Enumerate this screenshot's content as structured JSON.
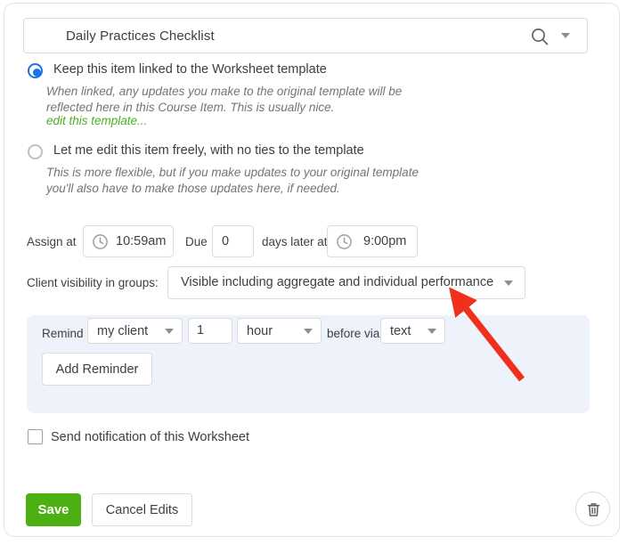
{
  "title_field": {
    "value": "Daily Practices Checklist",
    "search_icon": "search-icon",
    "dropdown_icon": "chevron-down-icon"
  },
  "options": {
    "linked": {
      "label": "Keep this item linked to the Worksheet template",
      "selected": true,
      "help": "When linked, any updates you make to the original template will be reflected here in this Course Item. This is usually nice.",
      "link_label": "edit this template..."
    },
    "free": {
      "label": "Let me edit this item freely, with no ties to the template",
      "selected": false,
      "help": "This is more flexible, but if you make updates to your original template you'll also have to make those updates here, if needed."
    }
  },
  "schedule": {
    "assign_label": "Assign at",
    "assign_time": "10:59am",
    "due_label": "Due",
    "due_days": "0",
    "days_later_label": "days later at",
    "due_time": "9:00pm"
  },
  "visibility": {
    "label": "Client visibility in groups:",
    "value": "Visible including aggregate and individual performance"
  },
  "reminder": {
    "remind_label": "Remind",
    "who": "my client",
    "amount": "1",
    "unit": "hour",
    "before_via_label": "before via",
    "channel": "text",
    "add_button": "Add Reminder"
  },
  "notification": {
    "label": "Send notification of this Worksheet",
    "checked": false
  },
  "footer": {
    "save_label": "Save",
    "cancel_label": "Cancel Edits",
    "delete_icon": "trash-icon"
  },
  "colors": {
    "accent_blue": "#1a73e8",
    "save_green": "#4caf12",
    "link_green": "#4caf28",
    "panel_blue": "#eef2fb",
    "arrow_red": "#f0301c"
  }
}
